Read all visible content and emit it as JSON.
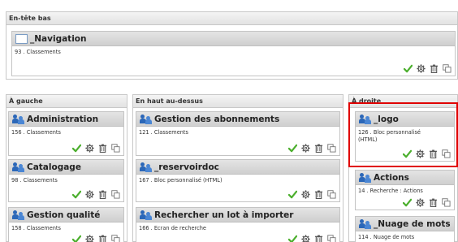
{
  "regions": {
    "top": "En-tête bas",
    "left": "À gauche",
    "center": "En haut au-dessus",
    "right": "À droite"
  },
  "blocks": {
    "navigation": {
      "title": "_Navigation",
      "desc": "93 . Classements"
    },
    "administration": {
      "title": "Administration",
      "desc": "156 . Classements"
    },
    "catalogage": {
      "title": "Catalogage",
      "desc": "98 . Classements"
    },
    "gestion_qualite": {
      "title": "Gestion qualité",
      "desc": "158 . Classements"
    },
    "gestion_abonnements": {
      "title": "Gestion des abonnements",
      "desc": "121 . Classements"
    },
    "reservoirdoc": {
      "title": "_reservoirdoc",
      "desc": "167 . Bloc personnalisé (HTML)"
    },
    "rechercher_lot": {
      "title": "Rechercher un lot à importer",
      "desc": "166 . Ecran de recherche"
    },
    "logo": {
      "title": "_logo",
      "desc": "126 . Bloc personnalisé (HTML)"
    },
    "actions": {
      "title": "Actions",
      "desc": "14 . Recherche : Actions"
    },
    "nuage_mots": {
      "title": "_Nuage de mots",
      "desc": "114 . Nuage de mots"
    }
  },
  "icons": {
    "block_icon": "people-icon",
    "nav_icon": "box-icon",
    "enable": "checkmark-icon",
    "settings": "gear-icon",
    "delete": "trash-icon",
    "duplicate": "copy-icon"
  },
  "colors": {
    "check": "#4caf2e",
    "selection": "#e00000",
    "accent": "#2b67b8"
  }
}
